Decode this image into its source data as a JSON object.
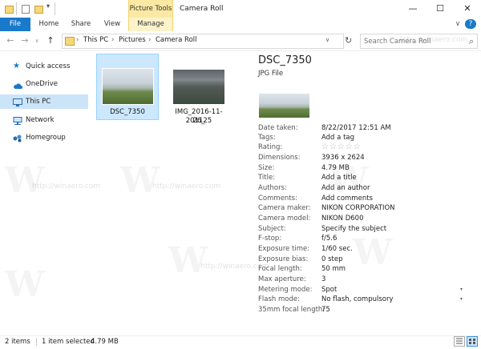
{
  "window": {
    "title": "Camera Roll",
    "context_tab": "Picture Tools",
    "controls": {
      "minimize": "—",
      "maximize": "☐",
      "close": "✕"
    }
  },
  "ribbon": {
    "tabs": [
      {
        "label": "File"
      },
      {
        "label": "Home"
      },
      {
        "label": "Share"
      },
      {
        "label": "View"
      },
      {
        "label": "Manage"
      }
    ],
    "collapse_glyph": "∨",
    "help_glyph": "?"
  },
  "navigation": {
    "back": "←",
    "forward": "→",
    "recent": "∨",
    "up": "↑",
    "breadcrumbs": [
      "This PC",
      "Pictures",
      "Camera Roll"
    ],
    "separator": "›",
    "dropdown": "∨",
    "refresh": "↻"
  },
  "search": {
    "placeholder": "Search Camera Roll",
    "icon": "⌕"
  },
  "sidebar": {
    "items": [
      {
        "label": "Quick access",
        "icon": "star-icon"
      },
      {
        "label": "OneDrive",
        "icon": "cloud-icon"
      },
      {
        "label": "This PC",
        "icon": "computer-icon",
        "selected": true
      },
      {
        "label": "Network",
        "icon": "network-icon"
      },
      {
        "label": "Homegroup",
        "icon": "homegroup-icon"
      }
    ]
  },
  "files": [
    {
      "name": "DSC_7350",
      "selected": true
    },
    {
      "name_line1": "IMG_2016-11-26_",
      "name_line2": "201125",
      "selected": false
    }
  ],
  "details": {
    "title": "DSC_7350",
    "type": "JPG File",
    "properties": [
      {
        "label": "Date taken:",
        "value": "8/22/2017 12:51 AM"
      },
      {
        "label": "Tags:",
        "value": "Add a tag"
      },
      {
        "label": "Rating:",
        "value": "☆☆☆☆☆"
      },
      {
        "label": "Dimensions:",
        "value": "3936 x 2624"
      },
      {
        "label": "Size:",
        "value": "4.79 MB"
      },
      {
        "label": "Title:",
        "value": "Add a title"
      },
      {
        "label": "Authors:",
        "value": "Add an author"
      },
      {
        "label": "Comments:",
        "value": "Add comments"
      },
      {
        "label": "Camera maker:",
        "value": "NIKON CORPORATION"
      },
      {
        "label": "Camera model:",
        "value": "NIKON D600"
      },
      {
        "label": "Subject:",
        "value": "Specify the subject"
      },
      {
        "label": "F-stop:",
        "value": "f/5.6"
      },
      {
        "label": "Exposure time:",
        "value": "1/60 sec."
      },
      {
        "label": "Exposure bias:",
        "value": "0 step"
      },
      {
        "label": "Focal length:",
        "value": "50 mm"
      },
      {
        "label": "Max aperture:",
        "value": "3"
      },
      {
        "label": "Metering mode:",
        "value": "Spot"
      },
      {
        "label": "Flash mode:",
        "value": "No flash, compulsory"
      },
      {
        "label": "35mm focal length:",
        "value": "75"
      }
    ],
    "dropdown_glyph": "▾"
  },
  "status": {
    "items_count": "2 items",
    "selection": "1 item selected",
    "size": "4.79 MB"
  },
  "watermark": {
    "text": "http://winaero.com",
    "logo": "W"
  },
  "colors": {
    "accent": "#1979ca",
    "selection": "#cce8ff",
    "context": "#fbe9a3"
  }
}
